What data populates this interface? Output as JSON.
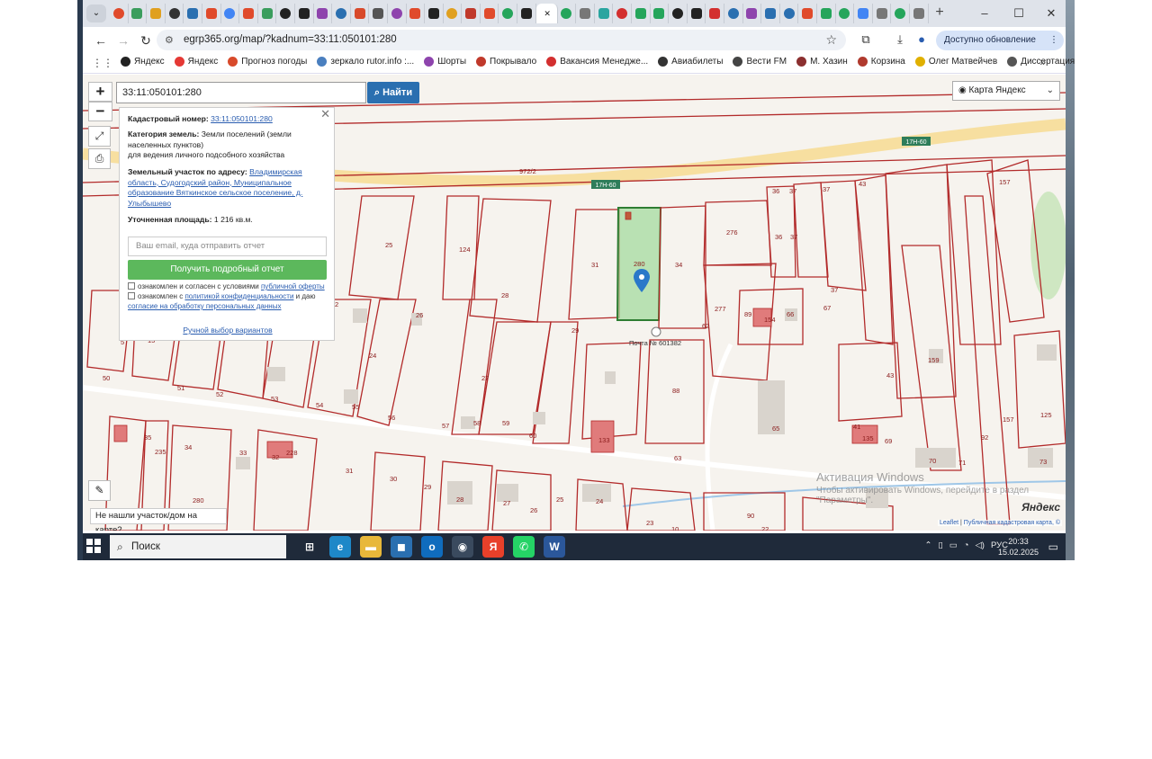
{
  "browser": {
    "tab_count": 44,
    "new_tab": "+",
    "window_controls": [
      "–",
      "☐",
      "✕"
    ],
    "url": "egrp365.org/map/?kadnum=33:11:050101:280",
    "update_button": "Доступно обновление Chrome",
    "bookmarks": [
      {
        "label": "Яндекс",
        "icon": "yandex-icon",
        "color": "#222222"
      },
      {
        "label": "Яндекс",
        "icon": "yandex-ya-icon",
        "color": "#e53935"
      },
      {
        "label": "Прогноз погоды",
        "icon": "weather-icon",
        "color": "#d84a2b"
      },
      {
        "label": "зеркало rutor.info :...",
        "icon": "rutor-icon",
        "color": "#4a7fbf"
      },
      {
        "label": "Шорты",
        "icon": "shorts-icon",
        "color": "#8e44ad"
      },
      {
        "label": "Покрывало",
        "icon": "pokryvalo-icon",
        "color": "#c0392b"
      },
      {
        "label": "Вакансия Менедже...",
        "icon": "hh-icon",
        "color": "#d32f2f"
      },
      {
        "label": "Авиабилеты",
        "icon": "plane-icon",
        "color": "#333333"
      },
      {
        "label": "Вести FM",
        "icon": "radio-icon",
        "color": "#444444"
      },
      {
        "label": "М. Хазин",
        "icon": "khazin-icon",
        "color": "#8b2f2f"
      },
      {
        "label": "Корзина",
        "icon": "cart-icon",
        "color": "#b03a2e"
      },
      {
        "label": "Олег Матвейчев",
        "icon": "play-icon",
        "color": "#e0b000"
      },
      {
        "label": "Диссертация на те...",
        "icon": "gear-icon",
        "color": "#555555"
      }
    ]
  },
  "map": {
    "zoom_in": "+",
    "zoom_out": "−",
    "search_value": "33:11:050101:280",
    "find_button": "Найти",
    "layer_select": "Карта Яндекс",
    "info": {
      "cad_label": "Кадастровый номер:",
      "cad_value": "33:11:050101:280",
      "cat_label": "Категория земель:",
      "cat_value": "Земли поселений (земли населенных пунктов)",
      "use_value": "для ведения личного подсобного хозяйства",
      "addr_label": "Земельный участок по адресу:",
      "addr_value": "Владимирская область, Судогодский район, Муниципальное образование Вяткинское сельское поселение, д. Улыбышево",
      "area_label": "Уточненная площадь:",
      "area_value": "1 216 кв.м.",
      "email_placeholder": "Ваш email, куда отправить отчет",
      "report_button": "Получить подробный отчет",
      "check1_text": "ознакомлен и согласен с условиями",
      "check1_link": "публичной оферты",
      "check2_text": "ознакомлен с",
      "check2_link": "политикой конфиденциальности",
      "check2_mid": "и даю",
      "check2_link2": "согласие на обработку персональных данных",
      "manual_link": "Ручной выбор вариантов"
    },
    "not_found": "Не нашли участок/дом на карте?",
    "yandex_logo": "Яндекс",
    "attribution_leaflet": "Leaflet",
    "attribution_sep": "|",
    "attribution_pkk": "Публичная кадастровая карта, ©",
    "roads": [
      "17Н-60",
      "17Н-60"
    ],
    "post_office": "Почта № 601382",
    "parcel_labels": [
      "972/2",
      "36",
      "37",
      "37",
      "43",
      "157",
      "276",
      "36",
      "37",
      "25",
      "124",
      "31",
      "280",
      "34",
      "28",
      "2",
      "26",
      "29",
      "277",
      "89",
      "154",
      "66",
      "67",
      "37",
      "5",
      "15",
      "24",
      "27",
      "62",
      "88",
      "43",
      "159",
      "50",
      "51",
      "52",
      "53",
      "54",
      "55",
      "56",
      "57",
      "58",
      "59",
      "60",
      "133",
      "65",
      "41",
      "135",
      "69",
      "70",
      "71",
      "92",
      "157",
      "125",
      "73",
      "63",
      "34",
      "33",
      "32",
      "228",
      "31",
      "30",
      "29",
      "28",
      "27",
      "26",
      "25",
      "24",
      "23",
      "10",
      "90",
      "22",
      "35",
      "235",
      "117",
      "280"
    ]
  },
  "watermark": {
    "line1": "Активация Windows",
    "line2": "Чтобы активировать Windows, перейдите в раздел",
    "line3": "\"Параметры\"."
  },
  "taskbar": {
    "search": "Поиск",
    "lang": "РУС",
    "time": "20:33",
    "date": "15.02.2025",
    "apps": [
      {
        "icon": "task-view-icon",
        "color": "#1f2a3a",
        "glyph": "⊞"
      },
      {
        "icon": "edge-icon",
        "color": "#1e88c8",
        "glyph": "e"
      },
      {
        "icon": "file-explorer-icon",
        "color": "#e8b83a",
        "glyph": "▬"
      },
      {
        "icon": "store-icon",
        "color": "#2a6fb0",
        "glyph": "◼"
      },
      {
        "icon": "outlook-icon",
        "color": "#0f6cbd",
        "glyph": "o"
      },
      {
        "icon": "chrome-icon",
        "color": "#3a4a5e",
        "glyph": "◉"
      },
      {
        "icon": "yandex-browser-icon",
        "color": "#e8402a",
        "glyph": "Я"
      },
      {
        "icon": "whatsapp-icon",
        "color": "#25d366",
        "glyph": "✆"
      },
      {
        "icon": "word-icon",
        "color": "#2b579a",
        "glyph": "W"
      }
    ]
  },
  "colors": {
    "parcel_line": "#b22a2a",
    "selected_parcel": "#9fd89a",
    "road": "#f7dfa0",
    "find_button": "#2a6fb0",
    "report_button": "#5cb85c"
  }
}
